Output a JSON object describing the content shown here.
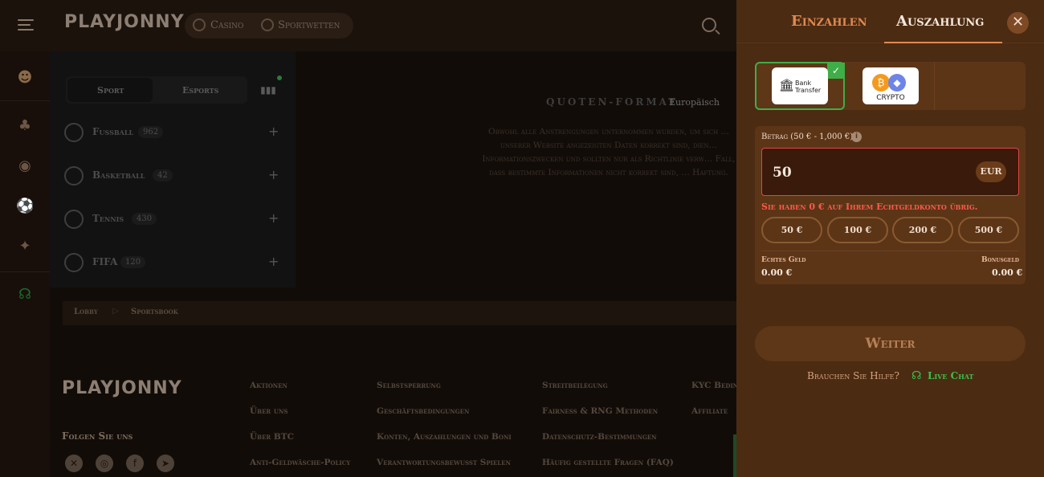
{
  "header": {
    "logo": "PLAYJONNY",
    "nav": [
      "Casino",
      "Sportwetten"
    ]
  },
  "sports": {
    "tabs": [
      "Sport",
      "Esports"
    ],
    "items": [
      {
        "name": "Fußball",
        "count": "962"
      },
      {
        "name": "Basketball",
        "count": "42"
      },
      {
        "name": "Tennis",
        "count": "430"
      },
      {
        "name": "FIFA",
        "count": "120"
      }
    ]
  },
  "odds": {
    "label": "QUOTEN-FORMAT",
    "value": "Europäisch",
    "disclaimer": "Obwohl alle Anstrengungen unternommen wurden, um sich … unserer Website angezeigten Daten korrekt sind, dien… Informationszwecken und sollten nur als Richtlinie verw… Fall, dass bestimmte Informationen nicht korrekt sind, … Haftung."
  },
  "breadcrumb": [
    "Lobby",
    "Sportsbook"
  ],
  "footer": {
    "logo": "PLAYJONNY",
    "follow": "Folgen Sie uns",
    "col1": [
      "Aktionen",
      "Über uns",
      "Über BTC",
      "Anti-Geldwäsche-Policy"
    ],
    "col2": [
      "Selbstsperrung",
      "Geschäftsbedingungen",
      "Konten, Auszahlungen und Boni",
      "Verantwortungsbewusst Spielen"
    ],
    "col3": [
      "Streitbeilegung",
      "Fairness & RNG Methoden",
      "Datenschutz-Bestimmungen",
      "Häufig gestellte Fragen (FAQ)"
    ],
    "col4": [
      "KYC Bedin…",
      "Affiliate"
    ]
  },
  "drawer": {
    "tab_deposit": "Einzahlen",
    "tab_withdraw": "Auszahlung",
    "methods": {
      "bank_line1": "Bank",
      "bank_line2": "Transfer",
      "crypto": "CRYPTO"
    },
    "amount_label": "Betrag (50 € - 1,000 €)",
    "amount_value": "50",
    "currency": "EUR",
    "error": "Sie haben 0 € auf Ihrem Echtgeldkonto übrig.",
    "quick_amounts": [
      "50 €",
      "100 €",
      "200 €",
      "500 €"
    ],
    "real_money_label": "Echtes Geld",
    "real_money_value": "0.00 €",
    "bonus_label": "Bonusgeld",
    "bonus_value": "0.00 €",
    "submit": "Weiter",
    "help_text": "Brauchen Sie Hilfe?",
    "live_chat": "Live Chat"
  },
  "colors": {
    "drawer_bg": "#4b2b12",
    "accent": "#e08a52",
    "success": "#3fae47",
    "error": "#ff5a4a"
  }
}
